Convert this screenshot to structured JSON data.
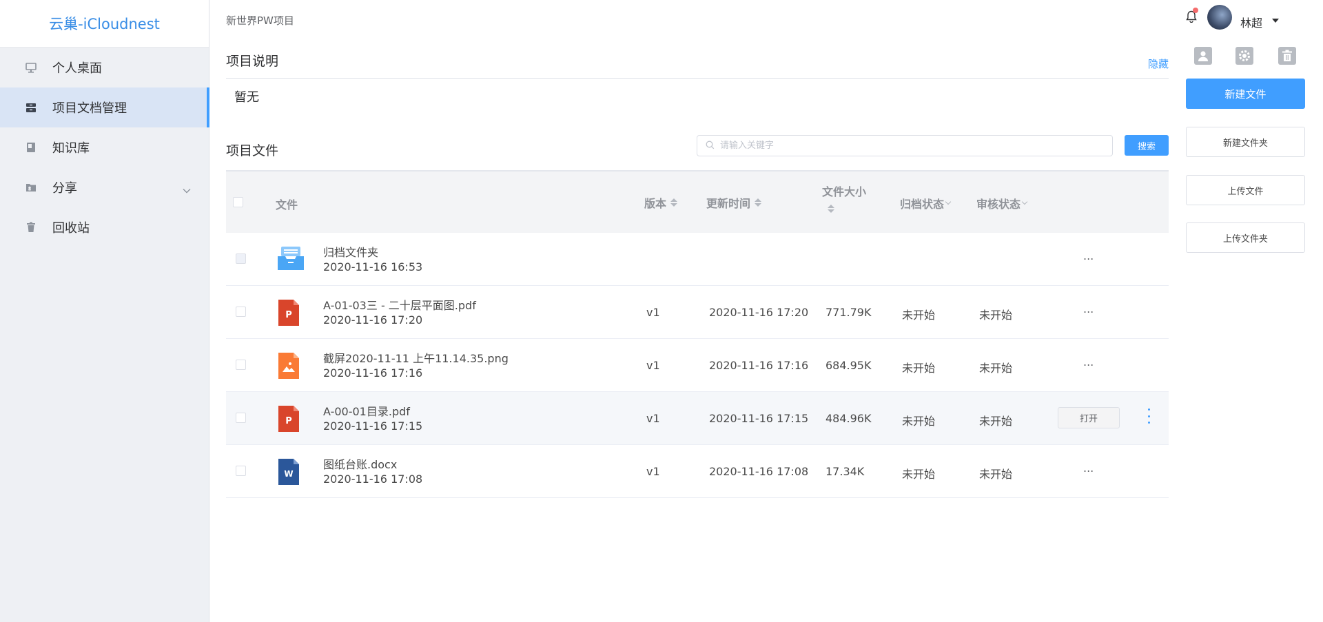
{
  "sidebar": {
    "brand": "云巢-iCloudnest",
    "items": [
      {
        "label": "个人桌面"
      },
      {
        "label": "项目文档管理"
      },
      {
        "label": "知识库"
      },
      {
        "label": "分享"
      },
      {
        "label": "回收站"
      }
    ]
  },
  "header": {
    "breadcrumb": "新世界PW项目",
    "user_name": "林超"
  },
  "description": {
    "title": "项目说明",
    "hide_label": "隐藏",
    "text": "暂无"
  },
  "files": {
    "title": "项目文件",
    "search_placeholder": "请输入关键字",
    "search_label": "搜索",
    "columns": {
      "file": "文件",
      "version": "版本",
      "updated": "更新时间",
      "size": "文件大小",
      "archive": "归档状态",
      "review": "审核状态"
    },
    "rows": [
      {
        "name": "归档文件夹",
        "time": "2020-11-16 16:53",
        "version": "",
        "updated": "",
        "size": "",
        "archive": "",
        "review": "",
        "more": "...",
        "icon": "archive-folder-icon"
      },
      {
        "name": "A-01-03三 - 二十层平面图.pdf",
        "time": "2020-11-16 17:20",
        "version": "v1",
        "updated": "2020-11-16 17:20",
        "size": "771.79K",
        "archive": "未开始",
        "review": "未开始",
        "more": "...",
        "icon": "pdf-file-icon"
      },
      {
        "name": "截屏2020-11-11 上午11.14.35.png",
        "time": "2020-11-16 17:16",
        "version": "v1",
        "updated": "2020-11-16 17:16",
        "size": "684.95K",
        "archive": "未开始",
        "review": "未开始",
        "more": "...",
        "icon": "image-file-icon"
      },
      {
        "name": "A-00-01目录.pdf",
        "time": "2020-11-16 17:15",
        "version": "v1",
        "updated": "2020-11-16 17:15",
        "size": "484.96K",
        "archive": "未开始",
        "review": "未开始",
        "open_label": "打开",
        "icon": "pdf-file-icon"
      },
      {
        "name": "图纸台账.docx",
        "time": "2020-11-16 17:08",
        "version": "v1",
        "updated": "2020-11-16 17:08",
        "size": "17.34K",
        "archive": "未开始",
        "review": "未开始",
        "more": "...",
        "icon": "word-file-icon"
      }
    ]
  },
  "actions": {
    "new_file": "新建文件",
    "new_folder": "新建文件夹",
    "upload_file": "上传文件",
    "upload_folder": "上传文件夹"
  },
  "colors": {
    "accent": "#409eff",
    "pdf": "#d9452b",
    "image": "#fa7a35",
    "word": "#2b579a",
    "folder": "#4aa6f5"
  }
}
